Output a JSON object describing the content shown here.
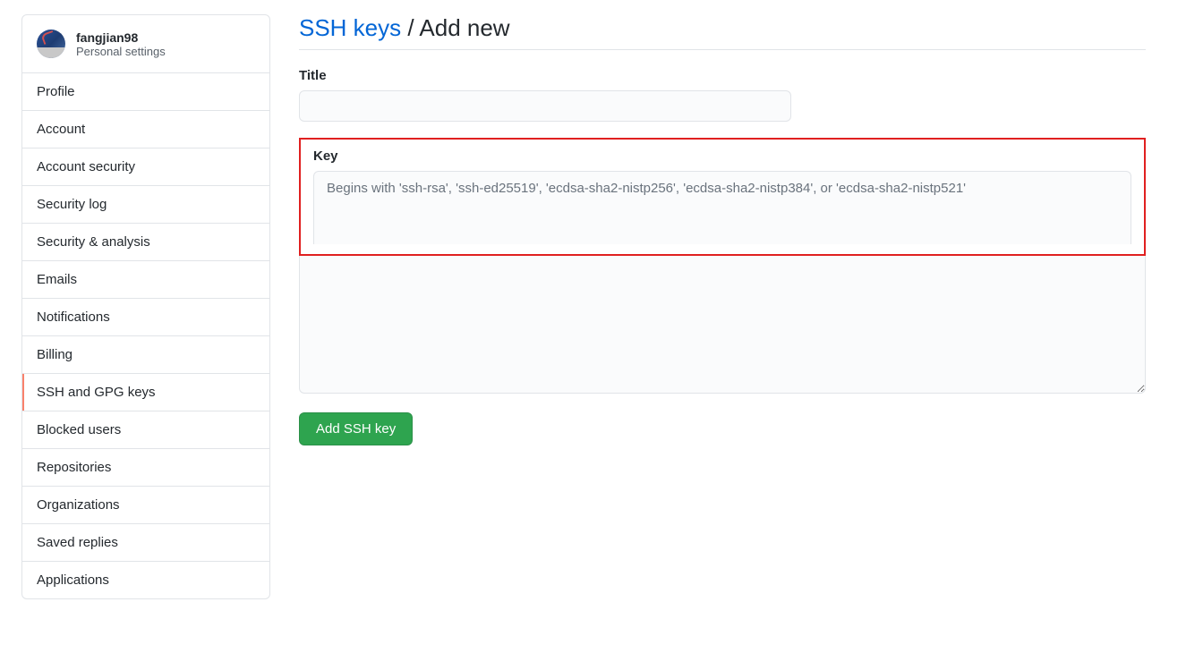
{
  "sidebar": {
    "username": "fangjian98",
    "subtitle": "Personal settings",
    "items": [
      {
        "label": "Profile",
        "active": false
      },
      {
        "label": "Account",
        "active": false
      },
      {
        "label": "Account security",
        "active": false
      },
      {
        "label": "Security log",
        "active": false
      },
      {
        "label": "Security & analysis",
        "active": false
      },
      {
        "label": "Emails",
        "active": false
      },
      {
        "label": "Notifications",
        "active": false
      },
      {
        "label": "Billing",
        "active": false
      },
      {
        "label": "SSH and GPG keys",
        "active": true
      },
      {
        "label": "Blocked users",
        "active": false
      },
      {
        "label": "Repositories",
        "active": false
      },
      {
        "label": "Organizations",
        "active": false
      },
      {
        "label": "Saved replies",
        "active": false
      },
      {
        "label": "Applications",
        "active": false
      }
    ]
  },
  "main": {
    "breadcrumb_link": "SSH keys",
    "breadcrumb_sep": " / ",
    "breadcrumb_current": "Add new",
    "title_label": "Title",
    "title_value": "",
    "key_label": "Key",
    "key_placeholder": "Begins with 'ssh-rsa', 'ssh-ed25519', 'ecdsa-sha2-nistp256', 'ecdsa-sha2-nistp384', or 'ecdsa-sha2-nistp521'",
    "key_value": "",
    "submit_label": "Add SSH key"
  }
}
